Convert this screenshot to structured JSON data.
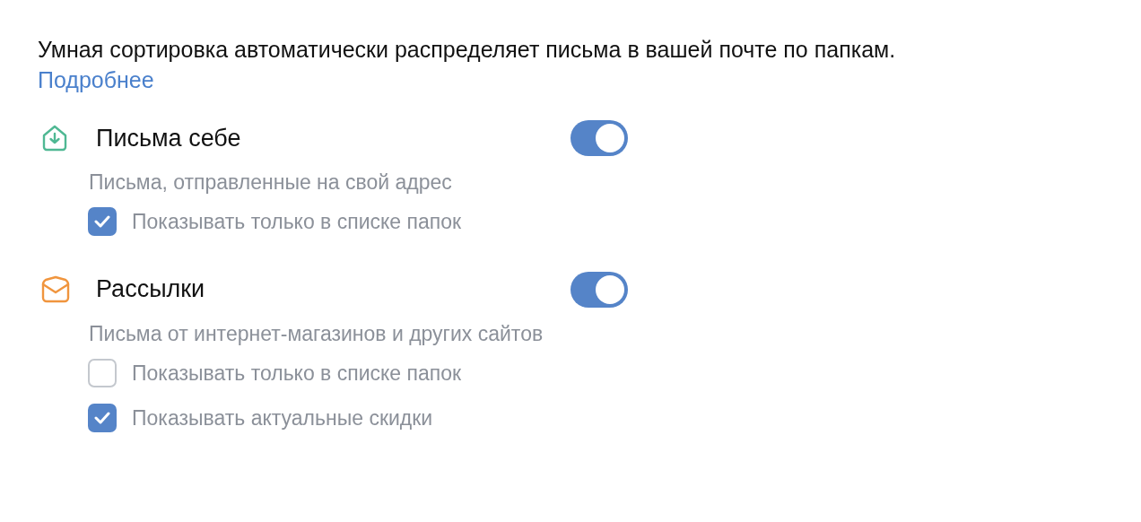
{
  "intro": {
    "text": "Умная сортировка автоматически распределяет письма в вашей почте по папкам.",
    "link": "Подробнее"
  },
  "categories": [
    {
      "kind": "inbox",
      "title": "Письма себе",
      "on": true,
      "description": "Письма, отправленные на свой адрес",
      "options": [
        {
          "label": "Показывать только в списке папок",
          "checked": true
        }
      ]
    },
    {
      "kind": "envelope",
      "title": "Рассылки",
      "on": true,
      "description": "Письма от интернет-магазинов и других сайтов",
      "options": [
        {
          "label": "Показывать только в списке папок",
          "checked": false
        },
        {
          "label": "Показывать актуальные скидки",
          "checked": true
        }
      ]
    }
  ]
}
